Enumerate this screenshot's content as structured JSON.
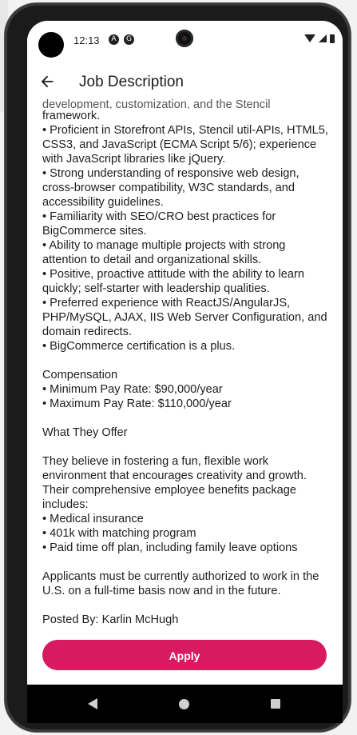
{
  "status": {
    "time": "12:13",
    "icon1": "A",
    "icon2": "G"
  },
  "appbar": {
    "back_icon": "arrow-left-icon",
    "title": "Job Description"
  },
  "content": {
    "partial_line": "development, customization, and the Stencil",
    "lines": [
      "framework.",
      "• Proficient in Storefront APIs, Stencil util-APIs, HTML5, CSS3, and JavaScript (ECMA Script 5/6); experience with JavaScript libraries like jQuery.",
      "• Strong understanding of responsive web design, cross-browser compatibility, W3C standards, and accessibility guidelines.",
      "• Familiarity with SEO/CRO best practices for BigCommerce sites.",
      "• Ability to manage multiple projects with strong attention to detail and organizational skills.",
      "• Positive, proactive attitude with the ability to learn quickly; self-starter with leadership qualities.",
      "• Preferred experience with ReactJS/AngularJS, PHP/MySQL, AJAX, IIS Web Server Configuration, and domain redirects.",
      "• BigCommerce certification is a plus."
    ],
    "compensation_heading": "Compensation",
    "compensation": [
      "• Minimum Pay Rate: $90,000/year",
      "• Maximum Pay Rate: $110,000/year"
    ],
    "offer_heading": "What They Offer",
    "offer_intro": "They believe in fostering a fun, flexible work environment that encourages creativity and growth. Their comprehensive employee benefits package includes:",
    "benefits": [
      "• Medical insurance",
      "• 401k with matching program",
      "• Paid time off plan, including family leave options"
    ],
    "authorization": "Applicants must be currently authorized to work in the U.S. on a full-time basis now and in the future.",
    "posted_by": "Posted By: Karlin McHugh"
  },
  "apply_label": "Apply",
  "colors": {
    "accent": "#d81b60"
  }
}
